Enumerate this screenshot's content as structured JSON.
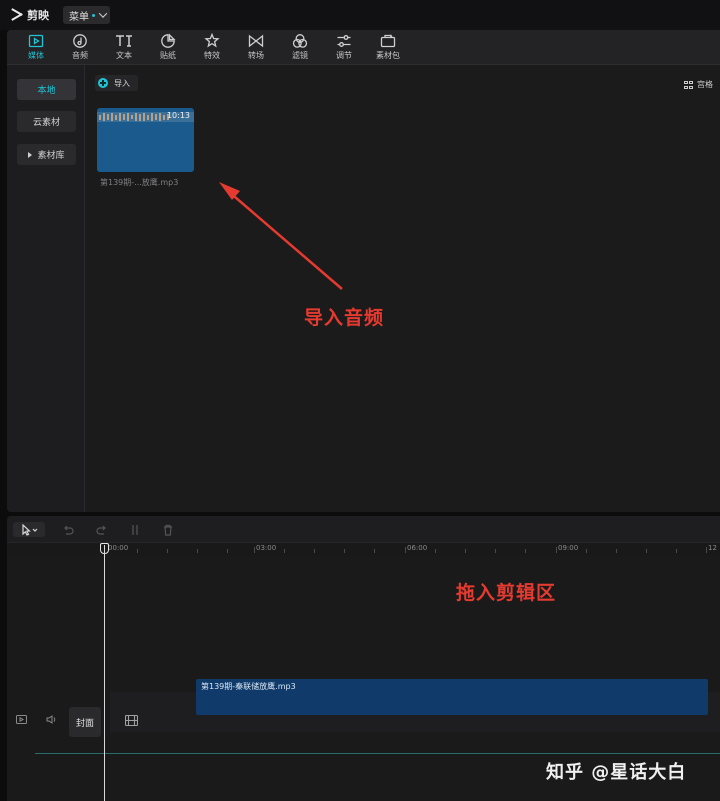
{
  "app": {
    "title": "剪映",
    "menu_label": "菜单"
  },
  "toolbar": {
    "items": [
      {
        "label": "媒体",
        "icon": "media-icon",
        "active": true
      },
      {
        "label": "音频",
        "icon": "audio-icon"
      },
      {
        "label": "文本",
        "icon": "text-icon"
      },
      {
        "label": "贴纸",
        "icon": "sticker-icon"
      },
      {
        "label": "特效",
        "icon": "effect-icon"
      },
      {
        "label": "转场",
        "icon": "transition-icon"
      },
      {
        "label": "滤镜",
        "icon": "filter-icon"
      },
      {
        "label": "调节",
        "icon": "adjust-icon"
      },
      {
        "label": "素材包",
        "icon": "package-icon"
      }
    ]
  },
  "sidebar": {
    "items": [
      {
        "label": "本地",
        "active": true
      },
      {
        "label": "云素材"
      },
      {
        "label": "素材库"
      }
    ]
  },
  "media": {
    "import_label": "导入",
    "view_label": "宫格",
    "clip": {
      "duration": "10:13",
      "name": "第139期-...放鹰.mp3"
    }
  },
  "annotations": {
    "import_audio": "导入音频",
    "drag_to_edit": "拖入剪辑区"
  },
  "timeline": {
    "ruler_labels": [
      "00:00",
      "03:00",
      "06:00",
      "09:00",
      "12"
    ],
    "clip_label": "第139期-秦联储放鹰.mp3",
    "cover_label": "封面"
  },
  "watermark": "知乎 @星话大白",
  "colors": {
    "accent": "#1fc5d6",
    "annotation": "#e53a2f",
    "clip": "#1a5a8c",
    "timeline_clip": "#0f3a69"
  }
}
